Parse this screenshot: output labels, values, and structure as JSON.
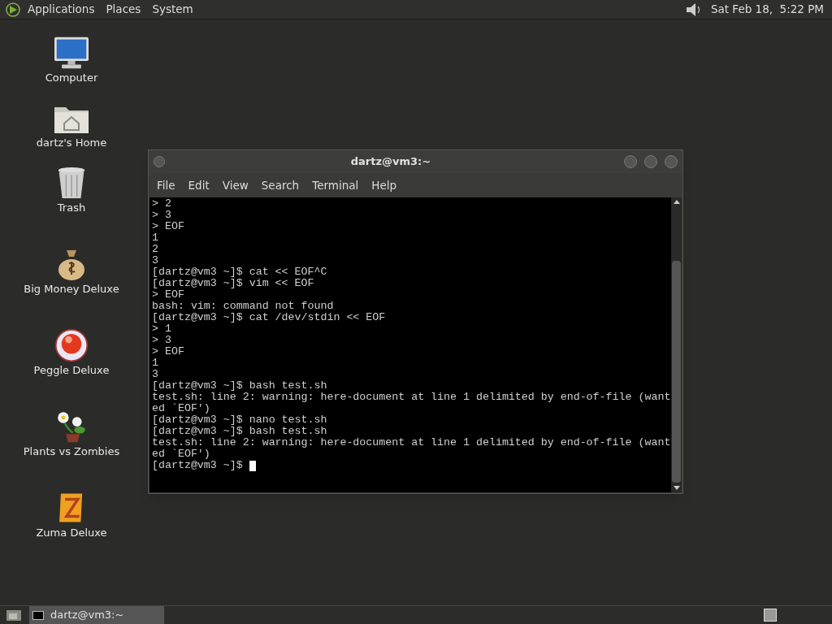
{
  "top_panel": {
    "menus": [
      "Applications",
      "Places",
      "System"
    ],
    "clock": "Sat Feb 18,  5:22 PM"
  },
  "desktop_icons": [
    {
      "kind": "computer",
      "label": "Computer"
    },
    {
      "kind": "home",
      "label": "dartz's Home"
    },
    {
      "kind": "trash",
      "label": "Trash"
    },
    {
      "kind": "money",
      "label": "Big Money Deluxe"
    },
    {
      "kind": "ball",
      "label": "Peggle Deluxe"
    },
    {
      "kind": "plant",
      "label": "Plants vs Zombies"
    },
    {
      "kind": "block",
      "label": "Zuma Deluxe"
    }
  ],
  "terminal": {
    "title": "dartz@vm3:~",
    "menu": [
      "File",
      "Edit",
      "View",
      "Search",
      "Terminal",
      "Help"
    ],
    "lines": [
      "> 2",
      "> 3",
      "> EOF",
      "1",
      "2",
      "3",
      "[dartz@vm3 ~]$ cat << EOF^C",
      "[dartz@vm3 ~]$ vim << EOF",
      "> EOF",
      "bash: vim: command not found",
      "[dartz@vm3 ~]$ cat /dev/stdin << EOF",
      "> 1",
      "> 3",
      "> EOF",
      "1",
      "3",
      "[dartz@vm3 ~]$ bash test.sh",
      "test.sh: line 2: warning: here-document at line 1 delimited by end-of-file (want",
      "ed `EOF')",
      "[dartz@vm3 ~]$ nano test.sh",
      "[dartz@vm3 ~]$ bash test.sh",
      "test.sh: line 2: warning: here-document at line 1 delimited by end-of-file (want",
      "ed `EOF')",
      "[dartz@vm3 ~]$"
    ]
  },
  "taskbar": {
    "tasks": [
      {
        "label": "dartz@vm3:~",
        "selected": true
      }
    ]
  }
}
